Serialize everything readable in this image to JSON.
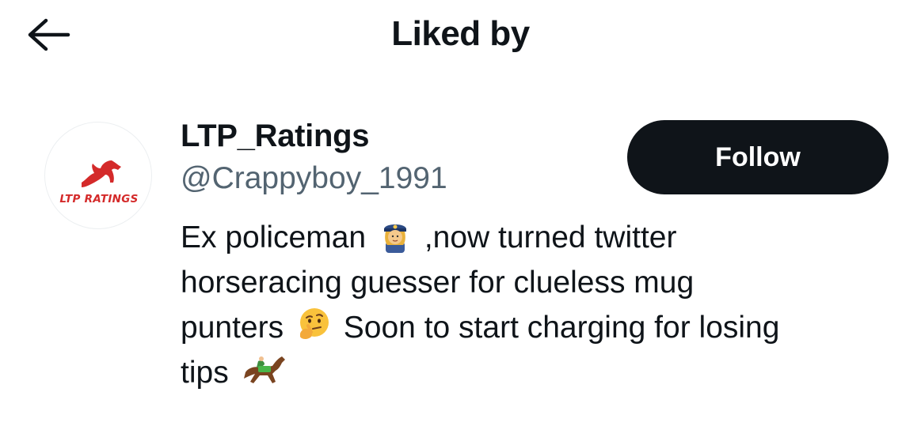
{
  "header": {
    "title": "Liked by",
    "back_icon": "arrow-left-icon"
  },
  "user": {
    "avatar_text": "LTP RATINGS",
    "avatar_color": "#d42a2a",
    "display_name": "LTP_Ratings",
    "handle": "@Crappyboy_1991",
    "follow_label": "Follow",
    "bio": {
      "line1_a": "Ex policeman",
      "emoji1": "policewoman-emoji",
      "line1_b": ",now turned twitter",
      "line2": "horseracing guesser for clueless mug",
      "line3_a": "punters",
      "emoji2": "thinking-face-emoji",
      "line3_b": "Soon to start charging for losing",
      "line4": "tips",
      "emoji3": "horse-racing-emoji"
    }
  },
  "colors": {
    "text": "#0f1419",
    "secondary": "#536471",
    "button_bg": "#0f1419",
    "button_text": "#ffffff"
  }
}
